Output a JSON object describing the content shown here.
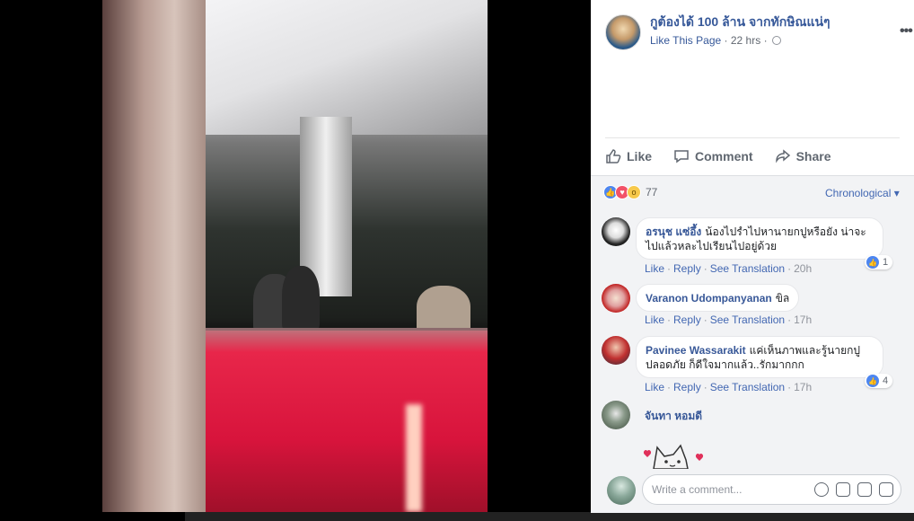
{
  "post": {
    "page_name": "กูต้องได้ 100 ล้าน จากทักษิณแน่ๆ",
    "like_page": "Like This Page",
    "separator": "·",
    "time": "22 hrs",
    "more": "•••"
  },
  "actions": {
    "like": "Like",
    "comment": "Comment",
    "share": "Share"
  },
  "reactions": {
    "count": "77",
    "sort": "Chronological ▾"
  },
  "comments": [
    {
      "name": "อรนุช แซ่อึ้ง",
      "text": "น้องไปรำไปหานายกปูหรือยัง น่าจะไปแล้วหละไปเรียนไปอยู่ด้วย",
      "like": "Like",
      "reply": "Reply",
      "translate": "See Translation",
      "time": "20h",
      "likes": "1"
    },
    {
      "name": "Varanon Udompanyanan",
      "text": "ขิล",
      "like": "Like",
      "reply": "Reply",
      "translate": "See Translation",
      "time": "17h"
    },
    {
      "name": "Pavinee Wassarakit",
      "text": "แค่เห็นภาพและรู้นายกปูปลอดภัย ก็ดีใจมากแล้ว..รักมากกก",
      "like": "Like",
      "reply": "Reply",
      "translate": "See Translation",
      "time": "17h",
      "likes": "4"
    },
    {
      "name": "จันทา หอมดี",
      "text": ""
    }
  ],
  "write": {
    "placeholder": "Write a comment..."
  },
  "icons": [
    "globe-icon",
    "more-icon",
    "like-icon",
    "comment-icon",
    "share-icon",
    "emoji-icon",
    "camera-icon",
    "gif-icon",
    "sticker-icon"
  ],
  "colors": {
    "link": "#365899",
    "accent": "#4267b2",
    "panel_bg": "#f2f3f5",
    "counter_red": "#e8264a"
  }
}
